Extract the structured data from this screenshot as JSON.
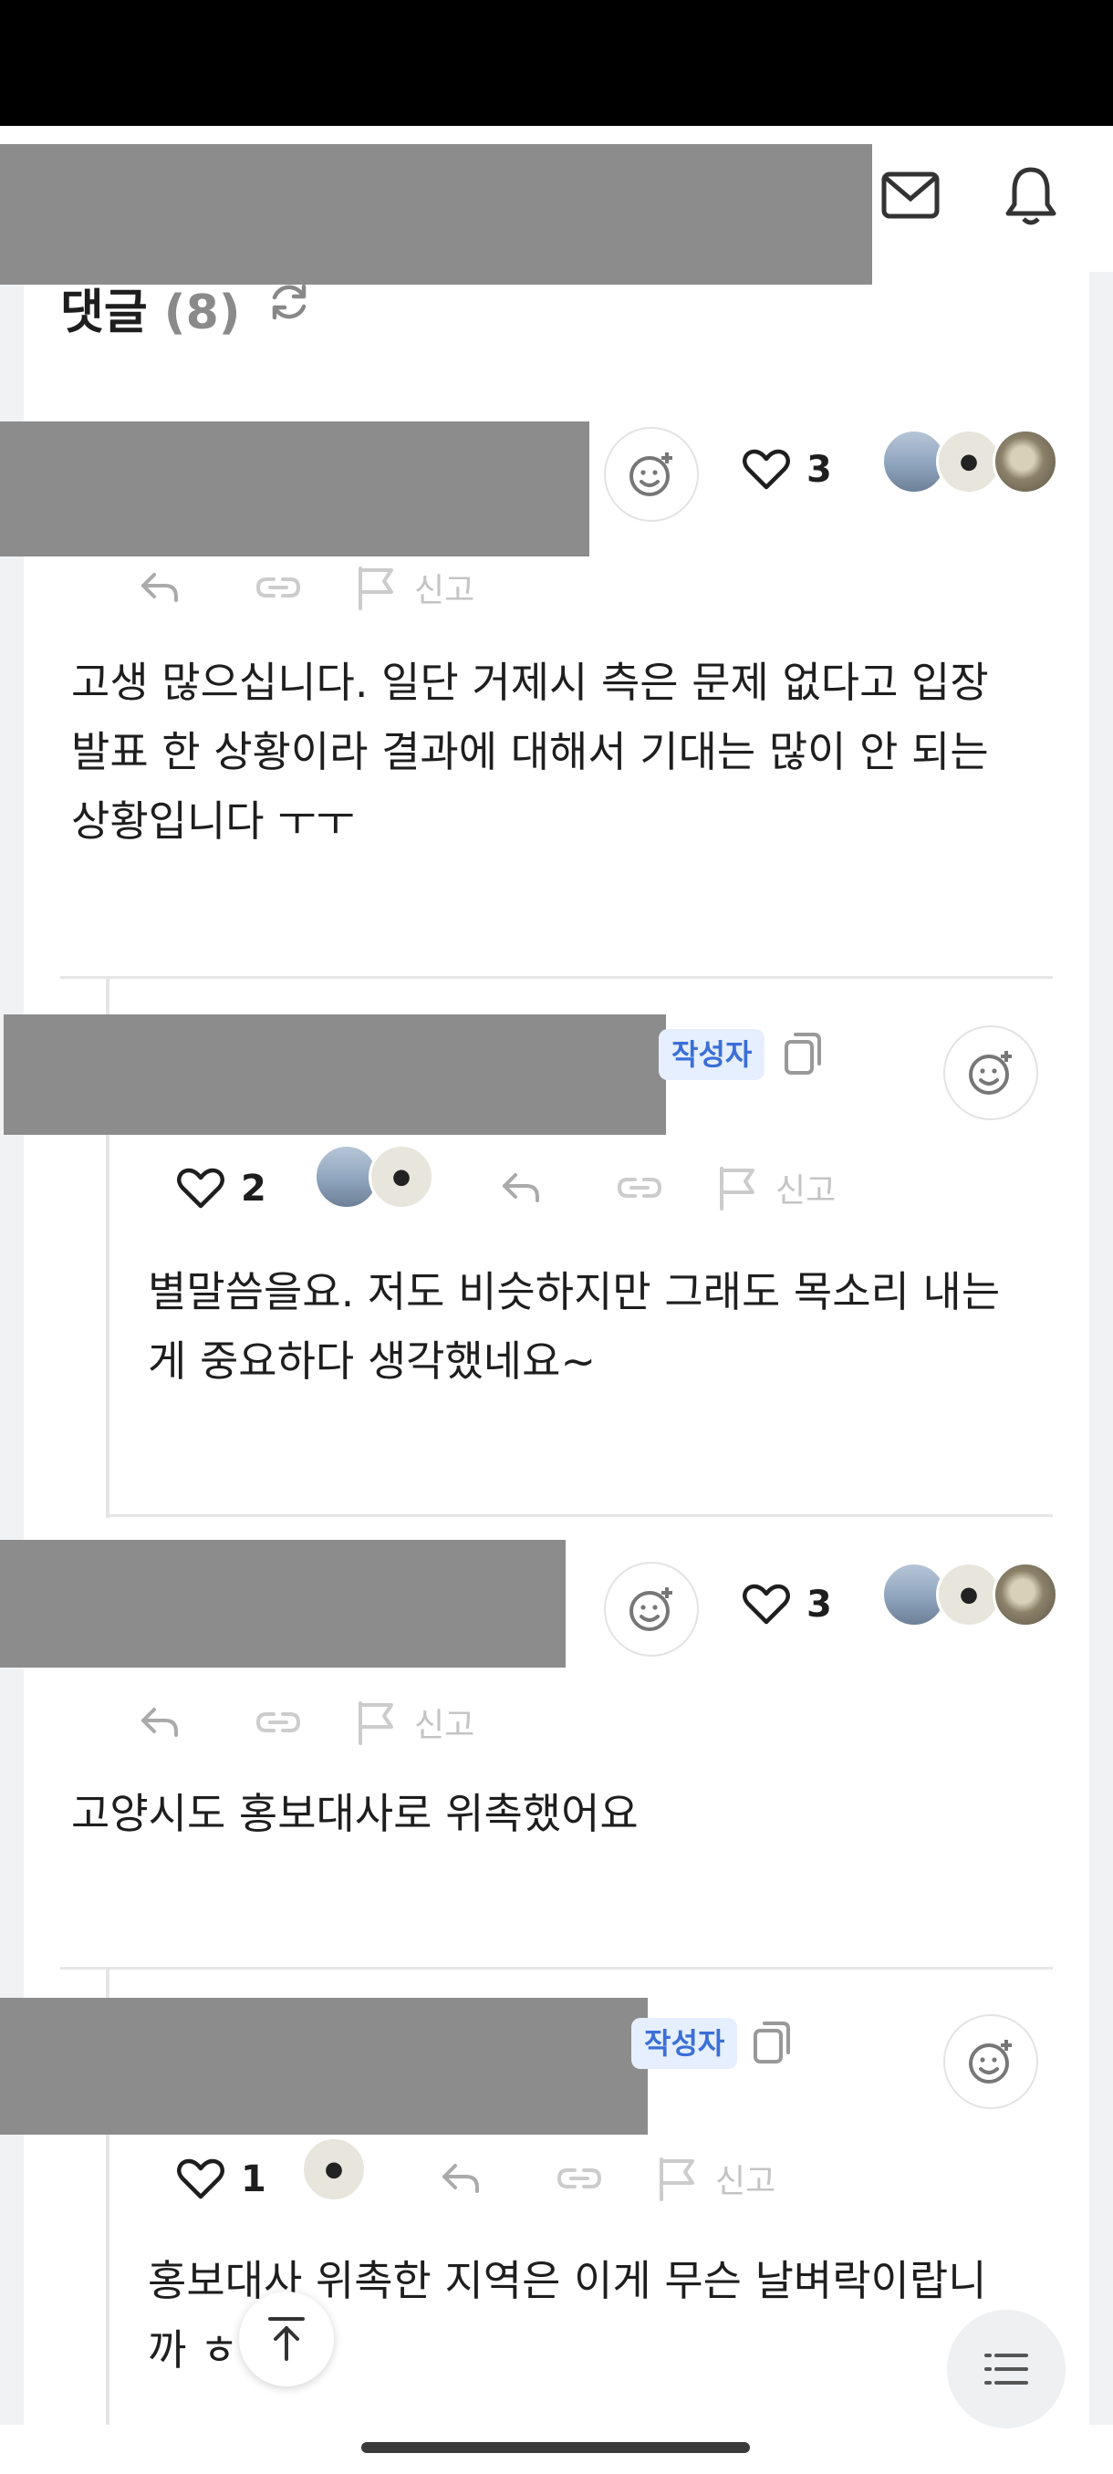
{
  "comments_header": {
    "title": "댓글",
    "count": "(8)"
  },
  "author_badge": "작성자",
  "report_label": "신고",
  "comments": [
    {
      "likes": "3",
      "text_lines": [
        "고생 많으십니다. 일단 거제시 측은 문제 없다고 입장",
        "발표 한 상황이라 결과에 대해서 기대는 많이 안 되는",
        "상황입니다 ㅜㅜ"
      ]
    },
    {
      "likes": "2",
      "text_lines": [
        "별말씀을요. 저도 비슷하지만 그래도 목소리 내는",
        "게 중요하다 생각했네요~"
      ]
    },
    {
      "likes": "3",
      "text_lines": [
        "고양시도 홍보대사로 위촉했어요"
      ]
    },
    {
      "likes": "1",
      "text_lines": [
        "홍보대사 위촉한 지역은 이게 무슨 날벼락이랍니",
        "까 ㅎ"
      ]
    }
  ],
  "icons": {
    "mail": "mail-icon",
    "bell": "bell-icon",
    "refresh": "refresh-icon",
    "add_reaction": "add-reaction-icon",
    "heart": "heart-icon",
    "reply": "reply-icon",
    "link": "link-icon",
    "flag": "flag-icon",
    "copy": "copy-icon",
    "scroll_top": "arrow-up-icon",
    "list": "list-icon"
  },
  "colors": {
    "badge_bg": "#e6efff",
    "badge_text": "#3b6fd8",
    "redaction": "#8c8c8c"
  }
}
